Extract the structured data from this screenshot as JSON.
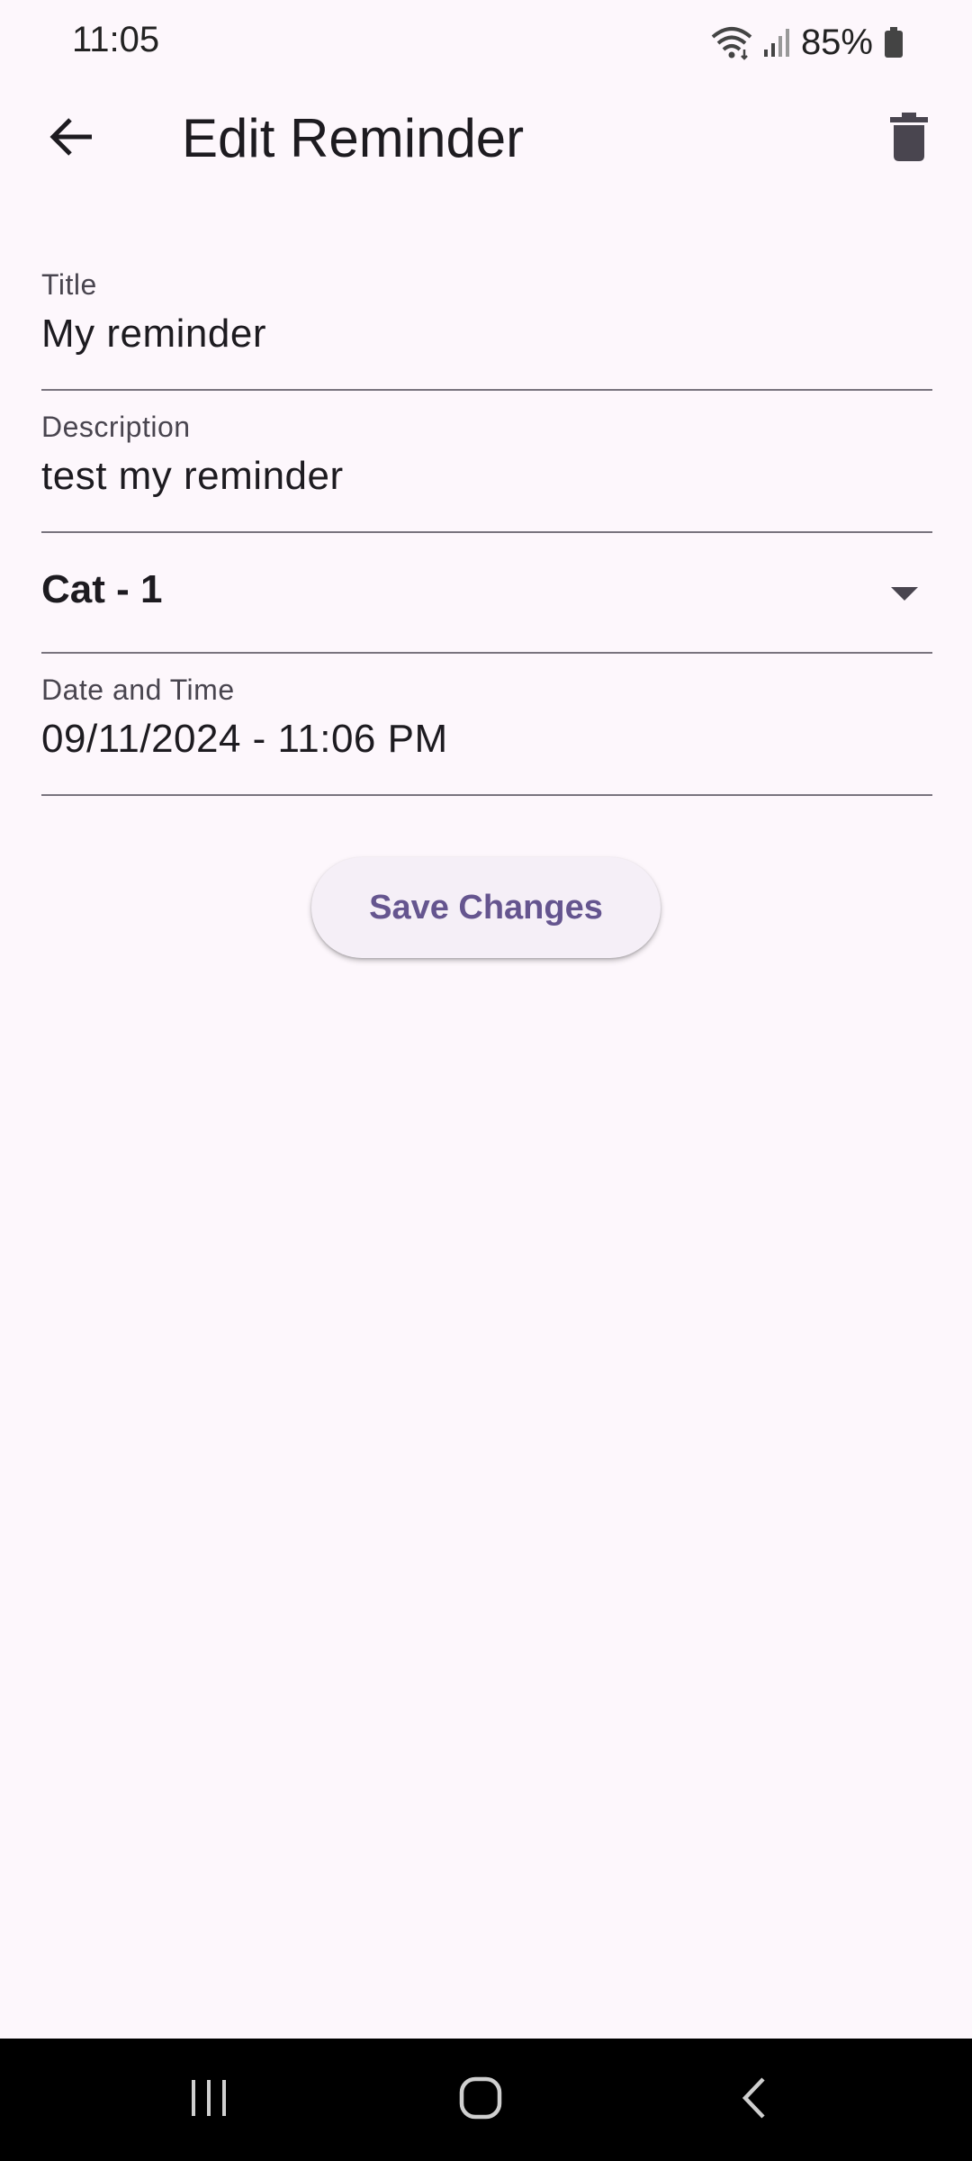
{
  "status_bar": {
    "time": "11:05",
    "battery": "85%",
    "icons": [
      "wifi-icon",
      "signal-icon",
      "battery-icon"
    ]
  },
  "app_bar": {
    "title": "Edit Reminder",
    "back_icon": "arrow-back-icon",
    "delete_icon": "trash-icon"
  },
  "form": {
    "title": {
      "label": "Title",
      "value": "My reminder"
    },
    "description": {
      "label": "Description",
      "value": "test my reminder"
    },
    "category": {
      "value": "Cat - 1"
    },
    "date_time": {
      "label": "Date and Time",
      "value": "09/11/2024 - 11:06 PM"
    }
  },
  "actions": {
    "save_label": "Save Changes"
  },
  "nav_bar": {
    "icons": [
      "recents-icon",
      "home-icon",
      "back-icon"
    ]
  },
  "colors": {
    "background": "#fdf7fc",
    "accent": "#65558f",
    "button_bg": "#f5eff7",
    "text": "#1d1b20"
  }
}
